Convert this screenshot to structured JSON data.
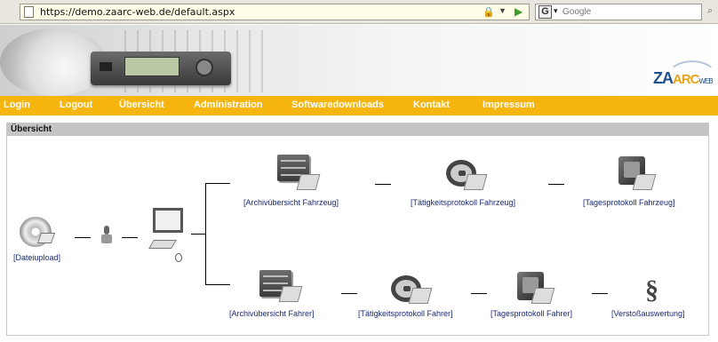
{
  "browser": {
    "url": "https://demo.zaarc-web.de/default.aspx",
    "search_placeholder": "Google",
    "search_engine_icon": "google-icon"
  },
  "banner": {
    "logo_za": "ZA",
    "logo_arc": "ARC",
    "logo_web": "WEB"
  },
  "nav": {
    "items": [
      {
        "label": "Login"
      },
      {
        "label": "Logout"
      },
      {
        "label": "Übersicht"
      },
      {
        "label": "Administration"
      },
      {
        "label": "Softwaredownloads"
      },
      {
        "label": "Kontakt"
      },
      {
        "label": "Impressum"
      }
    ],
    "color": "#f5b50c"
  },
  "page": {
    "title": "Übersicht"
  },
  "workflow": {
    "dateiupload": "[Dateiupload]",
    "top_row": [
      {
        "label": "[Archivübersicht Fahrzeug]",
        "icon": "archive-cabinet-icon"
      },
      {
        "label": "[Tätigkeitsprotokoll Fahrzeug]",
        "icon": "steering-wheel-icon"
      },
      {
        "label": "[Tagesprotokoll Fahrzeug]",
        "icon": "calendar-icon"
      }
    ],
    "bottom_row": [
      {
        "label": "[Archivübersicht Fahrer]",
        "icon": "archive-cabinet-icon"
      },
      {
        "label": "[Tätigkeitsprotokoll Fahrer]",
        "icon": "steering-wheel-icon"
      },
      {
        "label": "[Tagesprotokoll Fahrer]",
        "icon": "calendar-icon"
      },
      {
        "label": "[Verstoßauswertung]",
        "icon": "paragraph-icon"
      }
    ],
    "link_color": "#1a2a7a"
  }
}
